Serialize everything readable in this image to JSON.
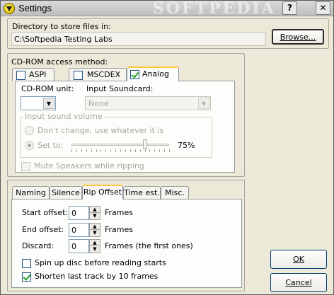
{
  "window": {
    "title": "Settings",
    "watermark": "SOFTPEDIA"
  },
  "titlebar_buttons": {
    "help": "?",
    "close": "✕"
  },
  "directory": {
    "label": "Directory to store files in:",
    "value": "C:\\Softpedia Testing Labs",
    "browse_label": "Browse..."
  },
  "cdrom": {
    "group_label": "CD-ROM access method:",
    "methods": [
      {
        "label": "ASPI",
        "checked": false
      },
      {
        "label": "MSCDEX",
        "checked": false
      },
      {
        "label": "Analog",
        "checked": true
      }
    ],
    "unit_label": "CD-ROM unit:",
    "unit_value": "",
    "soundcard_label": "Input Soundcard:",
    "soundcard_value": "None",
    "volume_group_label": "Input sound volume",
    "dont_change_label": "Don't change, use whatever it is",
    "set_to_label": "Set to:",
    "volume_percent": "75%",
    "volume_level": 0.75,
    "mute_label": "Mute Speakers while ripping"
  },
  "tabs": [
    {
      "label": "Naming",
      "active": false
    },
    {
      "label": "Silence",
      "active": false
    },
    {
      "label": "Rip Offset",
      "active": true
    },
    {
      "label": "Time est.",
      "active": false
    },
    {
      "label": "Misc.",
      "active": false
    }
  ],
  "rip_offset": {
    "start_label": "Start offset:",
    "start_value": "0",
    "end_label": "End offset:",
    "end_value": "0",
    "discard_label": "Discard:",
    "discard_value": "0",
    "frames_unit": "Frames",
    "discard_unit": "Frames (the first ones)",
    "spin_up_label": "Spin up disc before reading starts",
    "spin_up_checked": false,
    "shorten_label": "Shorten last track by 10 frames",
    "shorten_checked": true
  },
  "buttons": {
    "ok": "OK",
    "cancel": "Cancel"
  }
}
